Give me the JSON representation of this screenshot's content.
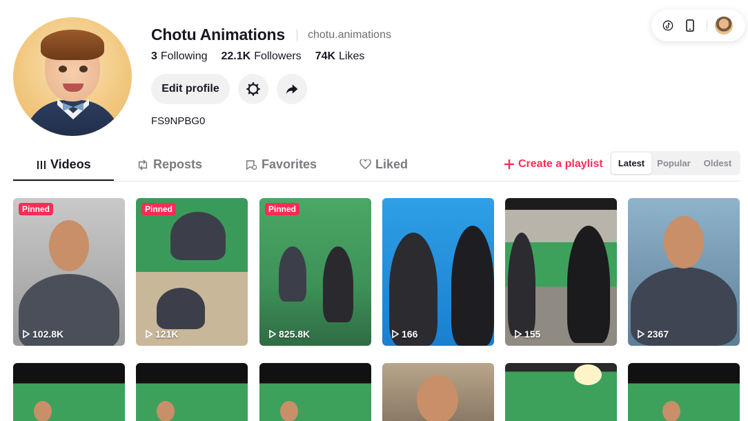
{
  "profile": {
    "name": "Chotu Animations",
    "handle": "chotu.animations",
    "stats": [
      {
        "value": "3",
        "label": "Following"
      },
      {
        "value": "22.1K",
        "label": "Followers"
      },
      {
        "value": "74K",
        "label": "Likes"
      }
    ],
    "edit_label": "Edit profile",
    "bio": "FS9NPBG0"
  },
  "tabs": [
    {
      "label": "Videos",
      "icon": "grid-lines-icon"
    },
    {
      "label": "Reposts",
      "icon": "repost-icon"
    },
    {
      "label": "Favorites",
      "icon": "bookmark-icon"
    },
    {
      "label": "Liked",
      "icon": "heart-outline-icon"
    }
  ],
  "create_playlist": "Create a playlist",
  "sort": [
    "Latest",
    "Popular",
    "Oldest"
  ],
  "videos": [
    {
      "pinned": "Pinned",
      "views": "102.8K"
    },
    {
      "pinned": "Pinned",
      "views": "121K"
    },
    {
      "pinned": "Pinned",
      "views": "825.8K"
    },
    {
      "pinned": "",
      "views": "166"
    },
    {
      "pinned": "",
      "views": "155"
    },
    {
      "pinned": "",
      "views": "2367"
    }
  ],
  "colors": {
    "accent": "#fe2c55",
    "text": "#161823",
    "muted": "#7a7b80"
  }
}
